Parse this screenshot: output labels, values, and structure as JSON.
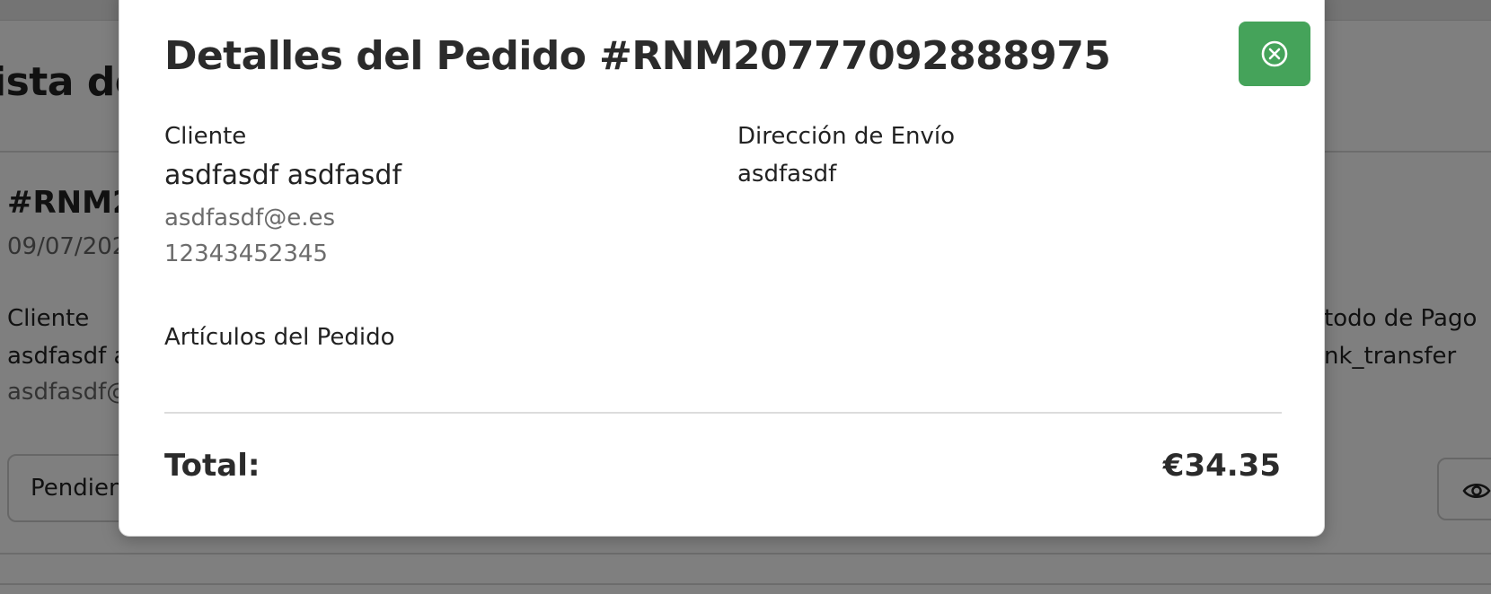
{
  "background": {
    "page_title_fragment": "ista de",
    "order_id_fragment": "#RNM2",
    "order_date_fragment": "09/07/202",
    "customer_label": "Cliente",
    "customer_name_fragment": "asdfasdf a",
    "customer_email_fragment": "asdfasdf@",
    "payment_label_fragment": "todo de Pago",
    "payment_value_fragment": "nk_transfer",
    "status_fragment": "Pendien",
    "view_icon": "eye-icon"
  },
  "modal": {
    "title": "Detalles del Pedido #RNM20777092888975",
    "close_icon": "close-circle-icon",
    "customer": {
      "label": "Cliente",
      "name": "asdfasdf asdfasdf",
      "email": "asdfasdf@e.es",
      "phone": "12343452345"
    },
    "shipping": {
      "label": "Dirección de Envío",
      "address": "asdfasdf"
    },
    "items_label": "Artículos del Pedido",
    "total_label": "Total:",
    "total_value": "€34.35"
  },
  "colors": {
    "close_button": "#45a35a",
    "overlay": "rgba(0,0,0,0.5)"
  }
}
